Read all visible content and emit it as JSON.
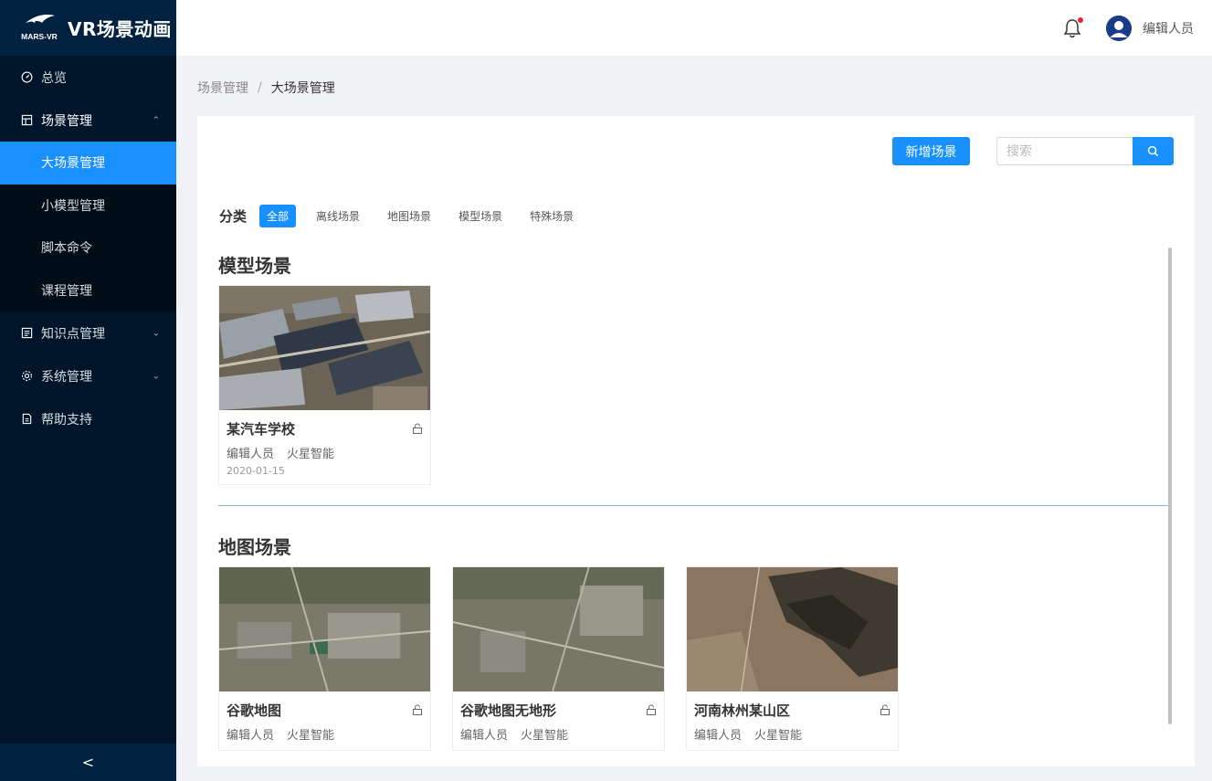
{
  "app": {
    "logo_text": "MARS-VR",
    "title": "VR场景动画"
  },
  "sidebar": {
    "items": [
      {
        "label": "总览",
        "icon": "dashboard-icon"
      },
      {
        "label": "场景管理",
        "icon": "scene-icon",
        "open": true,
        "children": [
          {
            "label": "大场景管理",
            "active": true
          },
          {
            "label": "小模型管理"
          },
          {
            "label": "脚本命令"
          },
          {
            "label": "课程管理"
          }
        ]
      },
      {
        "label": "知识点管理",
        "icon": "knowledge-icon"
      },
      {
        "label": "系统管理",
        "icon": "settings-icon"
      },
      {
        "label": "帮助支持",
        "icon": "help-icon"
      }
    ],
    "collapse_label": "<"
  },
  "header": {
    "user_name": "编辑人员"
  },
  "breadcrumb": {
    "parent": "场景管理",
    "separator": "/",
    "current": "大场景管理"
  },
  "toolbar": {
    "add_label": "新增场景",
    "search_placeholder": "搜索"
  },
  "filter": {
    "label": "分类",
    "tags": [
      "全部",
      "离线场景",
      "地图场景",
      "模型场景",
      "特殊场景"
    ],
    "active_index": 0
  },
  "sections": [
    {
      "title": "模型场景",
      "cards": [
        {
          "title": "某汽车学校",
          "author": "编辑人员",
          "org": "火星智能",
          "date": "2020-01-15"
        }
      ]
    },
    {
      "title": "地图场景",
      "cards": [
        {
          "title": "谷歌地图",
          "author": "编辑人员",
          "org": "火星智能"
        },
        {
          "title": "谷歌地图无地形",
          "author": "编辑人员",
          "org": "火星智能"
        },
        {
          "title": "河南林州某山区",
          "author": "编辑人员",
          "org": "火星智能"
        }
      ]
    }
  ],
  "colors": {
    "primary": "#1890ff",
    "sidebar_bg": "#001529",
    "submenu_bg": "#000c17",
    "badge": "#f5222d"
  }
}
